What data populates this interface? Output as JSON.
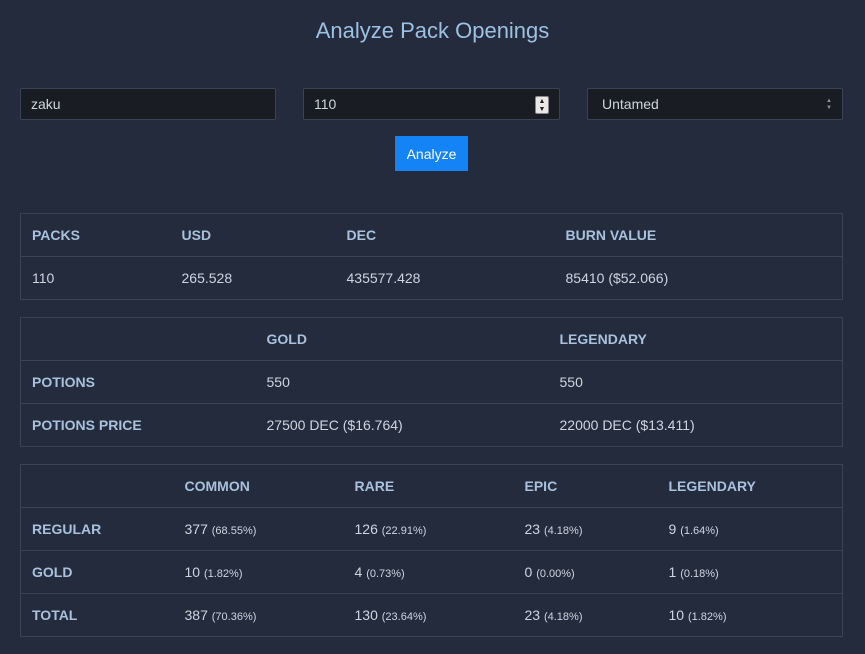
{
  "page": {
    "title": "Analyze Pack Openings"
  },
  "form": {
    "name_value": "zaku",
    "count_value": "110",
    "edition_selected": "Untamed",
    "analyze_label": "Analyze"
  },
  "summary": {
    "headers": [
      "PACKS",
      "USD",
      "DEC",
      "BURN VALUE"
    ],
    "values": [
      "110",
      "265.528",
      "435577.428",
      "85410 ($52.066)"
    ]
  },
  "potions": {
    "headers": [
      "",
      "GOLD",
      "LEGENDARY"
    ],
    "rows": [
      {
        "label": "POTIONS",
        "gold": "550",
        "legendary": "550"
      },
      {
        "label": "POTIONS PRICE",
        "gold": "27500 DEC ($16.764)",
        "legendary": "22000 DEC ($13.411)"
      }
    ]
  },
  "rarity": {
    "headers": [
      "",
      "COMMON",
      "RARE",
      "EPIC",
      "LEGENDARY"
    ],
    "rows": [
      {
        "label": "REGULAR",
        "common": "377",
        "common_pct": "(68.55%)",
        "rare": "126",
        "rare_pct": "(22.91%)",
        "epic": "23",
        "epic_pct": "(4.18%)",
        "legendary": "9",
        "legendary_pct": "(1.64%)"
      },
      {
        "label": "GOLD",
        "common": "10",
        "common_pct": "(1.82%)",
        "rare": "4",
        "rare_pct": "(0.73%)",
        "epic": "0",
        "epic_pct": "(0.00%)",
        "legendary": "1",
        "legendary_pct": "(0.18%)"
      },
      {
        "label": "TOTAL",
        "common": "387",
        "common_pct": "(70.36%)",
        "rare": "130",
        "rare_pct": "(23.64%)",
        "epic": "23",
        "epic_pct": "(4.18%)",
        "legendary": "10",
        "legendary_pct": "(1.82%)"
      }
    ]
  },
  "colors": {
    "background": "#232b3d",
    "accent": "#1483f5",
    "title": "#9dc1e3",
    "header_text": "#a9c1dc"
  }
}
